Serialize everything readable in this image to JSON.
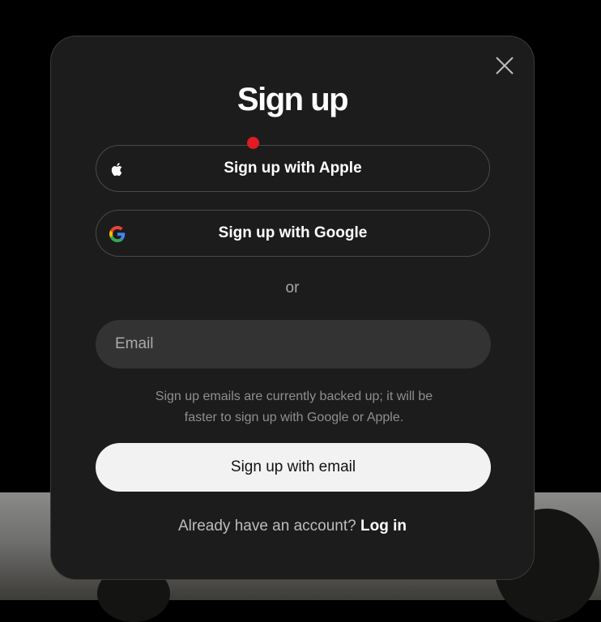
{
  "modal": {
    "title": "Sign up",
    "close_icon": "close-icon"
  },
  "providers": {
    "apple": {
      "label": "Sign up with Apple",
      "icon": "apple-icon"
    },
    "google": {
      "label": "Sign up with Google",
      "icon": "google-icon"
    }
  },
  "divider_text": "or",
  "email": {
    "placeholder": "Email",
    "value": ""
  },
  "notice": "Sign up emails are currently backed up; it will be faster to sign up with Google or Apple.",
  "email_button_label": "Sign up with email",
  "login": {
    "prompt": "Already have an account?",
    "link_label": "Log in"
  },
  "colors": {
    "modal_bg": "#1c1c1c",
    "notification_dot": "#e01b24",
    "primary_button_bg": "#f2f2f2"
  }
}
